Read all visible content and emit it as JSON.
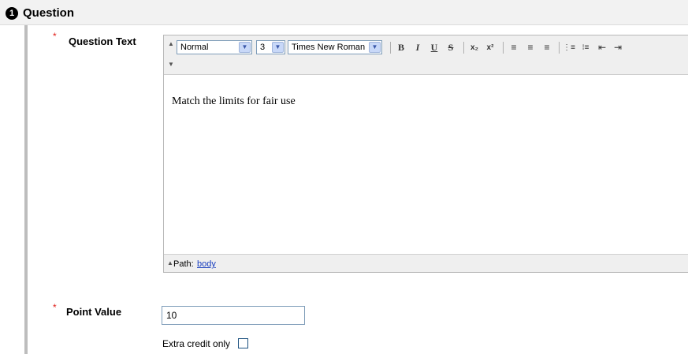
{
  "section": {
    "number": "1",
    "title": "Question"
  },
  "question_text": {
    "required_marker": "*",
    "label": "Question Text",
    "editor": {
      "style_select": "Normal",
      "size_select": "3",
      "font_select": "Times New Roman",
      "buttons": {
        "bold": "B",
        "italic": "I",
        "underline": "U",
        "strike": "S",
        "subscript": "x₂",
        "superscript": "x²",
        "align_left": "≡",
        "align_center": "≡",
        "align_right": "≡",
        "ordered_list": "⋮≡",
        "unordered_list": "⁝≡",
        "outdent": "⇤",
        "indent": "⇥"
      },
      "content": "Match the limits for fair use",
      "path_label": "Path:",
      "path_value": "body"
    }
  },
  "point_value": {
    "required_marker": "*",
    "label": "Point Value",
    "value": "10",
    "extra_credit_label": "Extra credit only",
    "extra_credit_checked": false
  }
}
